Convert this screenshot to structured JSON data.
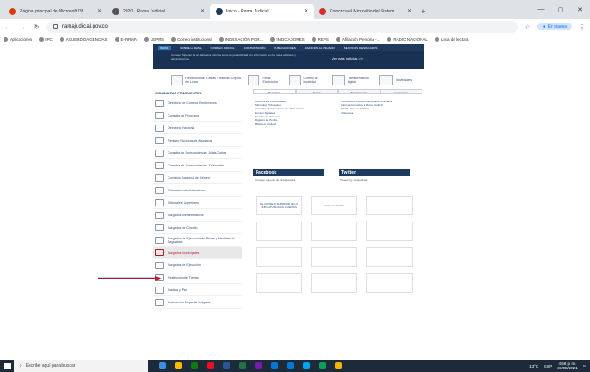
{
  "browser": {
    "tabs": [
      {
        "title": "Página principal de Microsoft Of...",
        "color": "#d83b01",
        "active": false
      },
      {
        "title": "2020 - Rama Judicial",
        "color": "#555555",
        "active": false
      },
      {
        "title": "Inicio - Rama Judicial",
        "color": "#1f3a5f",
        "active": true
      },
      {
        "title": "Conozca el Micrositio del Sistem...",
        "color": "#d93025",
        "active": false
      }
    ],
    "url": "ramajudicial.gov.co",
    "profile_label": "En pausa",
    "bookmarks": [
      "Aplicaciones",
      "IPC",
      "ACUERDO AGENCIAS",
      "E-FIRMA",
      "JEPMS",
      "Correo institucional",
      "INDEXACIÓN POR...",
      "INDICADORES",
      "REPS",
      "Afiliación Persona -...",
      "RADIO NACIONAL",
      "Lista de lectura"
    ]
  },
  "site": {
    "topnav": [
      "INICIO",
      "SOBRE LA RAMA",
      "CORREO JUDICIAL",
      "CONTRATACIÓN",
      "PUBLICACIONES",
      "ATENCIÓN AL USUARIO",
      "SERVICIOS DESTACADOS"
    ],
    "header_text": "Consejo Superior de la Judicatura informa sobre la productividad con información en los roles judiciales y administrativos",
    "more_news": "Ver más noticias >>",
    "tiles": [
      {
        "label": "Recepción de Tutelas y Habeas Corpus en Línea"
      },
      {
        "label": "Firma Electrónica"
      },
      {
        "label": "Control de legalidad"
      },
      {
        "label": "Transformación digital"
      },
      {
        "label": "Novedades"
      }
    ],
    "sidebar_title": "CONSULTAS FRECUENTES",
    "sidebar": [
      {
        "label": "Directorio de Correos Electrónicos",
        "selected": false
      },
      {
        "label": "Consulta de Procesos",
        "selected": false
      },
      {
        "label": "Directorio Nacional",
        "selected": false
      },
      {
        "label": "Registro Nacional de Abogados",
        "selected": false
      },
      {
        "label": "Consulta de Jurisprudencia - Altas Cortes",
        "selected": false
      },
      {
        "label": "Consulta de Jurisprudencia - Tribunales",
        "selected": false
      },
      {
        "label": "Comisión Nacional de Género",
        "selected": false
      },
      {
        "label": "Tribunales Administrativos",
        "selected": false
      },
      {
        "label": "Tribunales Superiores",
        "selected": false
      },
      {
        "label": "Juzgados Administrativos",
        "selected": false
      },
      {
        "label": "Juzgados de Circuito",
        "selected": false
      },
      {
        "label": "Juzgados de Ejecución de Penas y Medidas de Seguridad",
        "selected": false
      },
      {
        "label": "Juzgados Municipales",
        "selected": true
      },
      {
        "label": "Juzgados de Ejecución",
        "selected": false
      },
      {
        "label": "Restitución de Tierras",
        "selected": false
      },
      {
        "label": "Justicia y Paz",
        "selected": false
      },
      {
        "label": "Jurisdicción Especial Indígena",
        "selected": false
      }
    ],
    "mid_tabs": [
      "Servicios",
      "Temas",
      "Transparencia",
      "Información"
    ],
    "links_left": [
      "Avisos a las Comunidades",
      "Micrositios Tribunales",
      "Consultas Jurisprudencia de Altas Cortes",
      "Edictos Digitales",
      "Estados Electrónicos",
      "Registro de Peritos",
      "Biblioteca Judicial"
    ],
    "links_right": [
      "Consultas Procesos Nacionales Unificados",
      "Información sobre la Rama Judicial",
      "Tarifas Arancel Judicial",
      "Videoteca"
    ],
    "facebook_title": "Facebook",
    "facebook_sub": "Consejo Superior de la Judicatura",
    "twitter_title": "Twitter",
    "twitter_sub": "Tweets by ramajudicial",
    "banners": [
      "EL CONSEJO SUPERIOR DE LA JUDICATURA HACE CUENTAS",
      "Consulta Judicial",
      "",
      "",
      "",
      "",
      "",
      "",
      "",
      "",
      "",
      ""
    ]
  },
  "taskbar": {
    "search_placeholder": "Escribe aquí para buscar",
    "weather": "13°C",
    "lang": "ESP",
    "time": "4:58 p. m.",
    "date": "31/08/2021",
    "apps": [
      "#3c8ee5",
      "#ffb900",
      "#0f7b0f",
      "#e81123",
      "#2b579a",
      "#217346",
      "#7719aa",
      "#0078d7",
      "#0078d7",
      "#00a4ef",
      "#0f9d58",
      "#f4b400"
    ]
  },
  "colors": {
    "accent": "#1f3a5f",
    "arrow": "#c0182a"
  }
}
